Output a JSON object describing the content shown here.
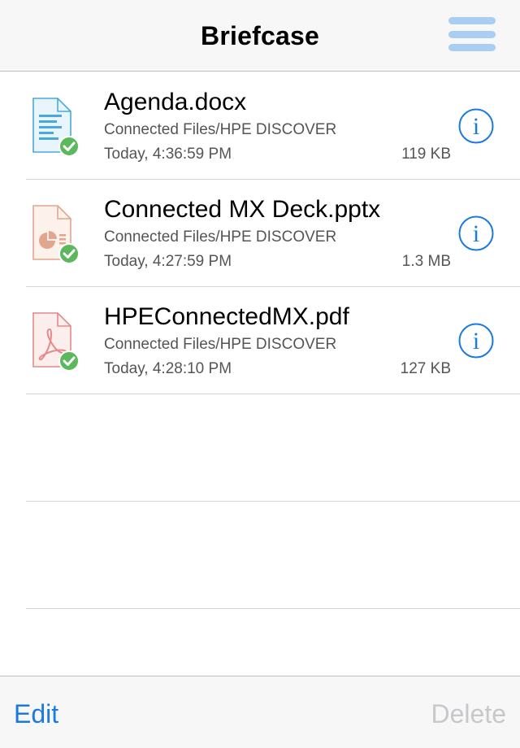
{
  "header": {
    "title": "Briefcase",
    "menu_icon": "hamburger-icon"
  },
  "files": [
    {
      "name": "Agenda.docx",
      "path": "Connected Files/HPE DISCOVER",
      "date": "Today, 4:36:59 PM",
      "size": "119 KB",
      "type": "docx",
      "status": "synced"
    },
    {
      "name": "Connected MX Deck.pptx",
      "path": "Connected Files/HPE DISCOVER",
      "date": "Today, 4:27:59 PM",
      "size": "1.3 MB",
      "type": "pptx",
      "status": "synced"
    },
    {
      "name": "HPEConnectedMX.pdf",
      "path": "Connected Files/HPE DISCOVER",
      "date": "Today, 4:28:10 PM",
      "size": "127 KB",
      "type": "pdf",
      "status": "synced"
    }
  ],
  "footer": {
    "edit_label": "Edit",
    "delete_label": "Delete"
  },
  "colors": {
    "accent": "#1a7ae0",
    "menu_icon": "#a9cdf3",
    "synced_badge": "#5cb85c",
    "docx": "#4aa8dc",
    "pptx": "#e2a58e",
    "pdf": "#e48a8a",
    "disabled": "#c7c7cc"
  }
}
